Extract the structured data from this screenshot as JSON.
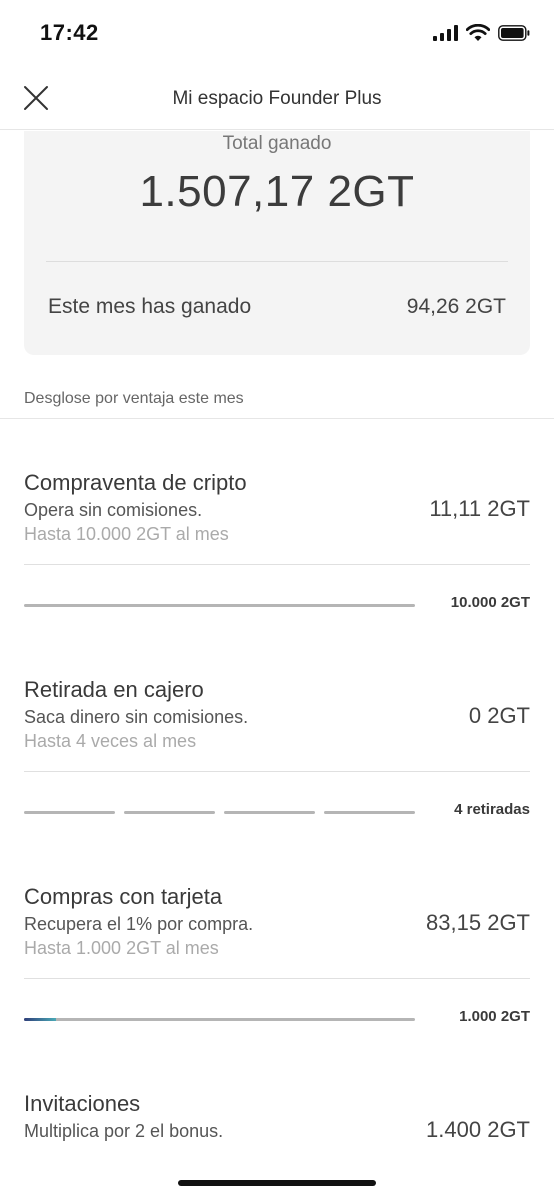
{
  "status": {
    "time": "17:42"
  },
  "header": {
    "title": "Mi espacio Founder Plus"
  },
  "summary": {
    "total_label": "Total ganado",
    "total_value": "1.507,17 2GT",
    "month_label": "Este mes has ganado",
    "month_value": "94,26 2GT"
  },
  "breakdown": {
    "label": "Desglose por ventaja este mes",
    "items": [
      {
        "title": "Compraventa de cripto",
        "desc": "Opera sin comisiones.",
        "limit": "Hasta 10.000 2GT al mes",
        "value": "11,11 2GT",
        "cap": "10.000 2GT",
        "segments": 1,
        "progress": 0.0011
      },
      {
        "title": "Retirada en cajero",
        "desc": "Saca dinero sin comisiones.",
        "limit": "Hasta 4 veces al mes",
        "value": "0 2GT",
        "cap": "4 retiradas",
        "segments": 4,
        "progress": 0
      },
      {
        "title": "Compras con tarjeta",
        "desc": "Recupera el 1% por compra.",
        "limit": "Hasta 1.000 2GT al mes",
        "value": "83,15 2GT",
        "cap": "1.000 2GT",
        "segments": 1,
        "progress": 0.083
      },
      {
        "title": "Invitaciones",
        "desc": "Multiplica por 2 el bonus.",
        "limit": "",
        "value": "1.400 2GT",
        "cap": "",
        "segments": 0,
        "progress": 0
      }
    ]
  },
  "icons": {
    "close": "close-icon",
    "signal": "cellular-signal-icon",
    "wifi": "wifi-icon",
    "battery": "battery-icon"
  },
  "colors": {
    "progress_start": "#2f3f7a",
    "progress_end": "#4aa9b6",
    "track": "#b5b5b5"
  }
}
